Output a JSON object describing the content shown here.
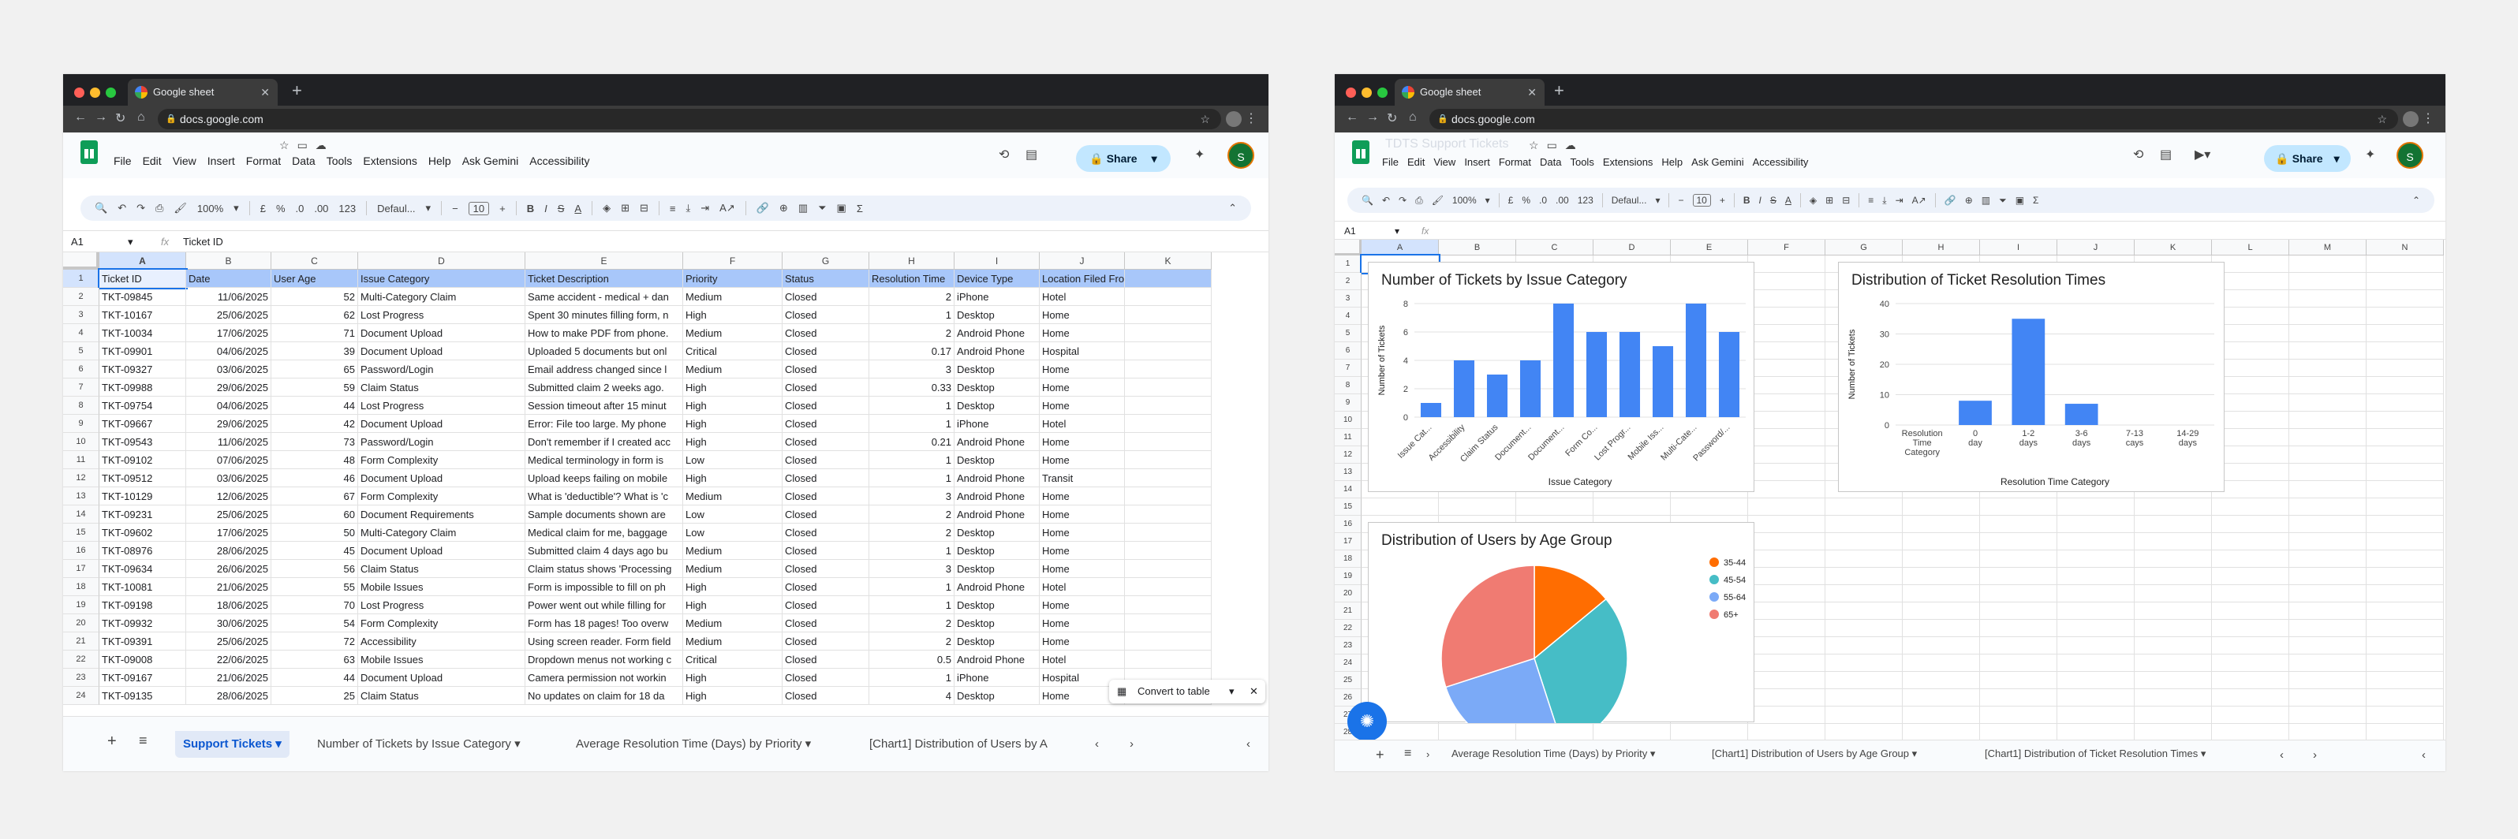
{
  "browser": {
    "tab_title": "Google sheet",
    "url": "docs.google.com",
    "new_tab_icon": "plus-icon"
  },
  "sheets_ui": {
    "menu": [
      "File",
      "Edit",
      "View",
      "Insert",
      "Format",
      "Data",
      "Tools",
      "Extensions",
      "Help",
      "Ask Gemini",
      "Accessibility"
    ],
    "share_label": "Share",
    "avatar_initial": "S",
    "doc_title_faint": "TDTS Support Tickets",
    "zoom": "100%",
    "currency": "£",
    "percent": "%",
    "dec_dec": ".0",
    "dec_inc": ".00",
    "num_fmt": "123",
    "font_name": "Defaul...",
    "font_size": "10",
    "fx": "fx"
  },
  "left": {
    "cell_ref": "A1",
    "formula": "Ticket ID",
    "columns": [
      "A",
      "B",
      "C",
      "D",
      "E",
      "F",
      "G",
      "H",
      "I",
      "J",
      "K"
    ],
    "headers": [
      "Ticket ID",
      "Date",
      "User Age",
      "Issue Category",
      "Ticket Description",
      "Priority",
      "Status",
      "Resolution Time",
      "Device Type",
      "Location Filed From",
      ""
    ],
    "rows": [
      [
        "TKT-09845",
        "11/06/2025",
        "52",
        "Multi-Category Claim",
        "Same accident - medical + dan",
        "Medium",
        "Closed",
        "2",
        "iPhone",
        "Hotel"
      ],
      [
        "TKT-10167",
        "25/06/2025",
        "62",
        "Lost Progress",
        "Spent 30 minutes filling form, n",
        "High",
        "Closed",
        "1",
        "Desktop",
        "Home"
      ],
      [
        "TKT-10034",
        "17/06/2025",
        "71",
        "Document Upload",
        "How to make PDF from phone.",
        "Medium",
        "Closed",
        "2",
        "Android Phone",
        "Home"
      ],
      [
        "TKT-09901",
        "04/06/2025",
        "39",
        "Document Upload",
        "Uploaded 5 documents but onl",
        "Critical",
        "Closed",
        "0.17",
        "Android Phone",
        "Hospital"
      ],
      [
        "TKT-09327",
        "03/06/2025",
        "65",
        "Password/Login",
        "Email address changed since l",
        "Medium",
        "Closed",
        "3",
        "Desktop",
        "Home"
      ],
      [
        "TKT-09988",
        "29/06/2025",
        "59",
        "Claim Status",
        "Submitted claim 2 weeks ago.",
        "High",
        "Closed",
        "0.33",
        "Desktop",
        "Home"
      ],
      [
        "TKT-09754",
        "04/06/2025",
        "44",
        "Lost Progress",
        "Session timeout after 15 minut",
        "High",
        "Closed",
        "1",
        "Desktop",
        "Home"
      ],
      [
        "TKT-09667",
        "29/06/2025",
        "42",
        "Document Upload",
        "Error: File too large. My phone",
        "High",
        "Closed",
        "1",
        "iPhone",
        "Hotel"
      ],
      [
        "TKT-09543",
        "11/06/2025",
        "73",
        "Password/Login",
        "Don't remember if I created acc",
        "High",
        "Closed",
        "0.21",
        "Android Phone",
        "Home"
      ],
      [
        "TKT-09102",
        "07/06/2025",
        "48",
        "Form Complexity",
        "Medical terminology in form is",
        "Low",
        "Closed",
        "1",
        "Desktop",
        "Home"
      ],
      [
        "TKT-09512",
        "03/06/2025",
        "46",
        "Document Upload",
        "Upload keeps failing on mobile",
        "High",
        "Closed",
        "1",
        "Android Phone",
        "Transit"
      ],
      [
        "TKT-10129",
        "12/06/2025",
        "67",
        "Form Complexity",
        "What is 'deductible'? What is 'c",
        "Medium",
        "Closed",
        "3",
        "Android Phone",
        "Home"
      ],
      [
        "TKT-09231",
        "25/06/2025",
        "60",
        "Document Requirements",
        "Sample documents shown are",
        "Low",
        "Closed",
        "2",
        "Android Phone",
        "Home"
      ],
      [
        "TKT-09602",
        "17/06/2025",
        "50",
        "Multi-Category Claim",
        "Medical claim for me, baggage",
        "Low",
        "Closed",
        "2",
        "Desktop",
        "Home"
      ],
      [
        "TKT-08976",
        "28/06/2025",
        "45",
        "Document Upload",
        "Submitted claim 4 days ago bu",
        "Medium",
        "Closed",
        "1",
        "Desktop",
        "Home"
      ],
      [
        "TKT-09634",
        "26/06/2025",
        "56",
        "Claim Status",
        "Claim status shows 'Processing",
        "Medium",
        "Closed",
        "3",
        "Desktop",
        "Home"
      ],
      [
        "TKT-10081",
        "21/06/2025",
        "55",
        "Mobile Issues",
        "Form is impossible to fill on ph",
        "High",
        "Closed",
        "1",
        "Android Phone",
        "Hotel"
      ],
      [
        "TKT-09198",
        "18/06/2025",
        "70",
        "Lost Progress",
        "Power went out while filling for",
        "High",
        "Closed",
        "1",
        "Desktop",
        "Home"
      ],
      [
        "TKT-09932",
        "30/06/2025",
        "54",
        "Form Complexity",
        "Form has 18 pages! Too overw",
        "Medium",
        "Closed",
        "2",
        "Desktop",
        "Home"
      ],
      [
        "TKT-09391",
        "25/06/2025",
        "72",
        "Accessibility",
        "Using screen reader. Form field",
        "Medium",
        "Closed",
        "2",
        "Desktop",
        "Home"
      ],
      [
        "TKT-09008",
        "22/06/2025",
        "63",
        "Mobile Issues",
        "Dropdown menus not working c",
        "Critical",
        "Closed",
        "0.5",
        "Android Phone",
        "Hotel"
      ],
      [
        "TKT-09167",
        "21/06/2025",
        "44",
        "Document Upload",
        "Camera permission not workin",
        "High",
        "Closed",
        "1",
        "iPhone",
        "Hospital"
      ],
      [
        "TKT-09135",
        "28/06/2025",
        "25",
        "Claim Status",
        "No updates on claim for 18 da",
        "High",
        "Closed",
        "4",
        "Desktop",
        "Home"
      ]
    ],
    "toast_label": "Convert to table",
    "sheet_tabs": [
      "Support Tickets",
      "Number of Tickets by Issue Category",
      "Average Resolution Time (Days) by Priority",
      "[Chart1] Distribution of Users by A"
    ]
  },
  "right": {
    "cell_ref": "A1",
    "columns": [
      "A",
      "B",
      "C",
      "D",
      "E",
      "F",
      "G",
      "H",
      "I",
      "J",
      "K",
      "L",
      "M",
      "N"
    ],
    "sheet_tabs": [
      "Average Resolution Time (Days) by Priority",
      "[Chart1] Distribution of Users by Age Group",
      "[Chart1] Distribution of Ticket Resolution Times"
    ]
  },
  "chart_data": [
    {
      "type": "bar",
      "title": "Number of Tickets by Issue Category",
      "xlabel": "Issue Category",
      "ylabel": "Number of Tickets",
      "categories": [
        "Issue Cat...",
        "Accessibility",
        "Claim Status",
        "Document...",
        "Document...",
        "Form Co...",
        "Lost Progr...",
        "Mobile Iss...",
        "Multi-Cate...",
        "Password/..."
      ],
      "values": [
        1,
        4,
        3,
        4,
        8,
        6,
        6,
        5,
        8,
        6
      ],
      "ylim": [
        0,
        8
      ],
      "yticks": [
        "0",
        "2",
        "4",
        "6",
        "8"
      ],
      "color": "#4285f4"
    },
    {
      "type": "bar",
      "title": "Distribution of Ticket Resolution Times",
      "xlabel": "Resolution Time Category",
      "ylabel": "Number of Tickets",
      "categories": [
        "Resolution Time Category",
        "0 day",
        "1-2 days",
        "3-6 days",
        "7-13 cays",
        "14-29 days"
      ],
      "values": [
        0,
        8,
        35,
        7,
        0,
        0
      ],
      "ylim": [
        0,
        40
      ],
      "yticks": [
        "0",
        "10",
        "20",
        "30",
        "40"
      ],
      "color": "#4285f4"
    },
    {
      "type": "pie",
      "title": "Distribution of Users by Age Group",
      "labels": [
        "35-44",
        "45-54",
        "55-64",
        "65+"
      ],
      "values": [
        14,
        31,
        25,
        30
      ],
      "colors": [
        "#ff6d01",
        "#46bdc6",
        "#7baaf7",
        "#f07b72"
      ]
    }
  ]
}
